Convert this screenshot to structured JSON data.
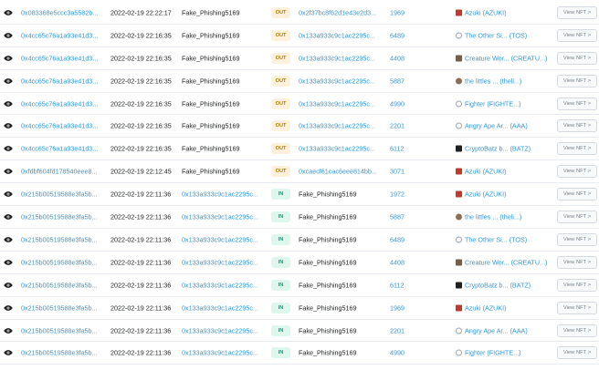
{
  "columns_hidden": true,
  "button_label": "View NFT >",
  "rows": [
    {
      "hash": "0x083368e5ccc3a5582b...",
      "age": "2022-02-19 22:22:17",
      "from": "Fake_Phishing5169",
      "dir": "OUT",
      "to": "0x2f37bc8f62d1e43e2d3...",
      "qty": "1969",
      "token": "Azuki (AZUKI)",
      "icon": "azuki"
    },
    {
      "hash": "0x4cc65c76a1a93e41d3...",
      "age": "2022-02-19 22:16:35",
      "from": "Fake_Phishing5169",
      "dir": "OUT",
      "to": "0x133a933c9c1ac2295c...",
      "qty": "6489",
      "token": "The Other Si... (TOS)",
      "icon": "other"
    },
    {
      "hash": "0x4cc65c76a1a93e41d3...",
      "age": "2022-02-19 22:16:35",
      "from": "Fake_Phishing5169",
      "dir": "OUT",
      "to": "0x133a933c9c1ac2295c...",
      "qty": "4408",
      "token": "Creature Wor... (CREATU...)",
      "icon": "creature"
    },
    {
      "hash": "0x4cc65c76a1a93e41d3...",
      "age": "2022-02-19 22:16:35",
      "from": "Fake_Phishing5169",
      "dir": "OUT",
      "to": "0x133a933c9c1ac2295c...",
      "qty": "5887",
      "token": "the littles ... (theli...)",
      "icon": "littles"
    },
    {
      "hash": "0x4cc65c76a1a93e41d3...",
      "age": "2022-02-19 22:16:35",
      "from": "Fake_Phishing5169",
      "dir": "OUT",
      "to": "0x133a933c9c1ac2295c...",
      "qty": "4990",
      "token": "Fighter (FIGHTE...)",
      "icon": "fighter"
    },
    {
      "hash": "0x4cc65c76a1a93e41d3...",
      "age": "2022-02-19 22:16:35",
      "from": "Fake_Phishing5169",
      "dir": "OUT",
      "to": "0x133a933c9c1ac2295c...",
      "qty": "2201",
      "token": "Angry Ape Ar... (AAA)",
      "icon": "angry"
    },
    {
      "hash": "0x4cc65c76a1a93e41d3...",
      "age": "2022-02-19 22:16:35",
      "from": "Fake_Phishing5169",
      "dir": "OUT",
      "to": "0x133a933c9c1ac2295c...",
      "qty": "6112",
      "token": "CryptoBatz b... (BATZ)",
      "icon": "cryptobatz"
    },
    {
      "hash": "0xfdbf604fd178540eee8...",
      "age": "2022-02-19 22:12:45",
      "from": "Fake_Phishing5169",
      "dir": "OUT",
      "to": "0xcaecf61cac6eee814bb...",
      "qty": "3071",
      "token": "Azuki (AZUKI)",
      "icon": "azuki"
    },
    {
      "hash": "0x215b00519588e3fa5b...",
      "age": "2022-02-19 22:11:36",
      "from": "0x133a933c9c1ac2295c...",
      "dir": "IN",
      "to": "Fake_Phishing5169",
      "qty": "1972",
      "token": "Azuki (AZUKI)",
      "icon": "azuki"
    },
    {
      "hash": "0x215b00519588e3fa5b...",
      "age": "2022-02-19 22:11:36",
      "from": "0x133a933c9c1ac2295c...",
      "dir": "IN",
      "to": "Fake_Phishing5169",
      "qty": "5887",
      "token": "the littles ... (theli...)",
      "icon": "littles"
    },
    {
      "hash": "0x215b00519588e3fa5b...",
      "age": "2022-02-19 22:11:36",
      "from": "0x133a933c9c1ac2295c...",
      "dir": "IN",
      "to": "Fake_Phishing5169",
      "qty": "6489",
      "token": "The Other Si... (TOS)",
      "icon": "other"
    },
    {
      "hash": "0x215b00519588e3fa5b...",
      "age": "2022-02-19 22:11:36",
      "from": "0x133a933c9c1ac2295c...",
      "dir": "IN",
      "to": "Fake_Phishing5169",
      "qty": "4408",
      "token": "Creature Wor... (CREATU...)",
      "icon": "creature"
    },
    {
      "hash": "0x215b00519588e3fa5b...",
      "age": "2022-02-19 22:11:36",
      "from": "0x133a933c9c1ac2295c...",
      "dir": "IN",
      "to": "Fake_Phishing5169",
      "qty": "6112",
      "token": "CryptoBatz b... (BATZ)",
      "icon": "cryptobatz"
    },
    {
      "hash": "0x215b00519588e3fa5b...",
      "age": "2022-02-19 22:11:36",
      "from": "0x133a933c9c1ac2295c...",
      "dir": "IN",
      "to": "Fake_Phishing5169",
      "qty": "1969",
      "token": "Azuki (AZUKI)",
      "icon": "azuki"
    },
    {
      "hash": "0x215b00519588e3fa5b...",
      "age": "2022-02-19 22:11:36",
      "from": "0x133a933c9c1ac2295c...",
      "dir": "IN",
      "to": "Fake_Phishing5169",
      "qty": "2201",
      "token": "Angry Ape Ar... (AAA)",
      "icon": "angry"
    },
    {
      "hash": "0x215b00519588e3fa5b...",
      "age": "2022-02-19 22:11:36",
      "from": "0x133a933c9c1ac2295c...",
      "dir": "IN",
      "to": "Fake_Phishing5169",
      "qty": "4990",
      "token": "Fighter (FIGHTE...)",
      "icon": "fighter"
    }
  ]
}
